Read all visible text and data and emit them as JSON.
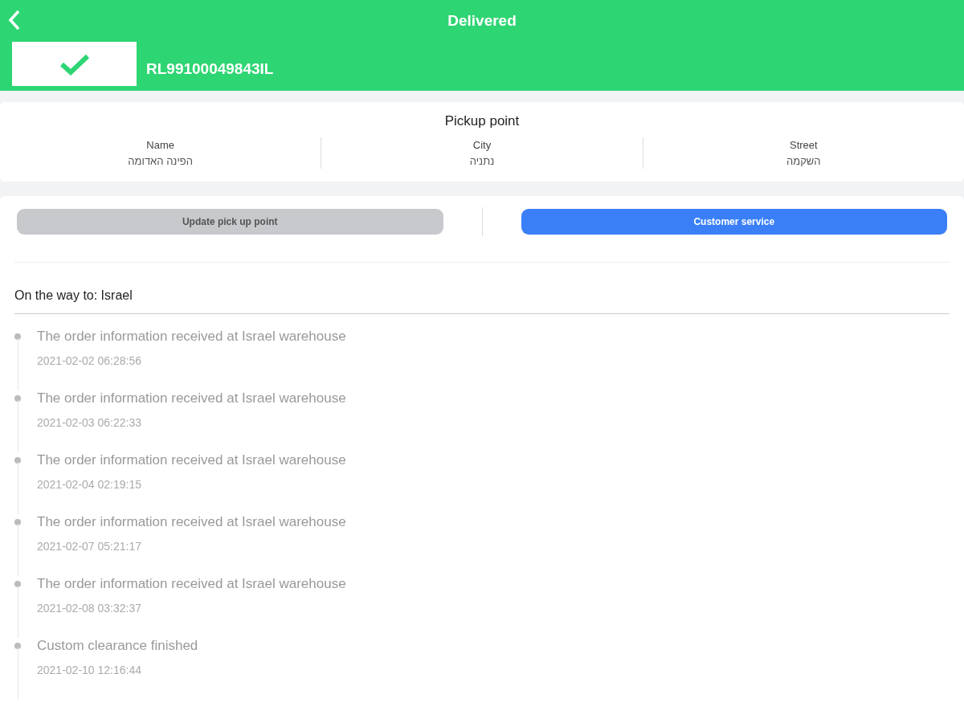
{
  "header": {
    "title": "Delivered",
    "tracking_number": "RL99100049843IL"
  },
  "pickup_point": {
    "title": "Pickup point",
    "name": {
      "label": "Name",
      "value": "הפינה האדומה"
    },
    "city": {
      "label": "City",
      "value": "נתניה"
    },
    "street": {
      "label": "Street",
      "value": "השקמה"
    }
  },
  "buttons": [
    {
      "label": "Update pick up point",
      "disabled": true
    },
    {
      "label": "Customer service",
      "disabled": false
    }
  ],
  "route": "On the way to: Israel",
  "events": [
    {
      "text": "The order information received at Israel warehouse",
      "time": "2021-02-02 06:28:56"
    },
    {
      "text": "The order information received at Israel warehouse",
      "time": "2021-02-03 06:22:33"
    },
    {
      "text": "The order information received at Israel warehouse",
      "time": "2021-02-04 02:19:15"
    },
    {
      "text": "The order information received at Israel warehouse",
      "time": "2021-02-07 05:21:17"
    },
    {
      "text": "The order information received at Israel warehouse",
      "time": "2021-02-08 03:32:37"
    },
    {
      "text": "Custom clearance finished",
      "time": "2021-02-10 12:16:44"
    }
  ]
}
